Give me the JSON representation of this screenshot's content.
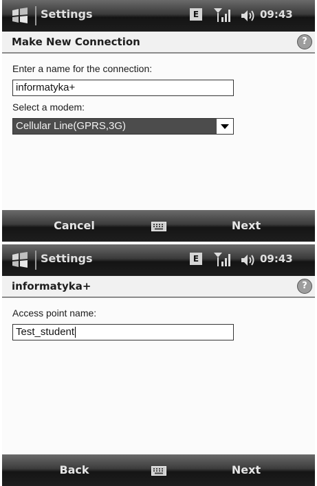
{
  "screens": [
    {
      "title_bar": {
        "app_title": "Settings",
        "network_badge": "E",
        "time": "09:43",
        "icons": [
          "windows-start-icon",
          "signal-icon",
          "speaker-icon"
        ]
      },
      "header": {
        "title": "Make New Connection",
        "help_label": "?"
      },
      "form": {
        "name_label": "Enter a name for the connection:",
        "name_value": "informatyka+",
        "modem_label": "Select a modem:",
        "modem_value": "Cellular Line(GPRS,3G)"
      },
      "softkeys": {
        "left": "Cancel",
        "right": "Next",
        "center_icon": "keyboard-icon"
      }
    },
    {
      "title_bar": {
        "app_title": "Settings",
        "network_badge": "E",
        "time": "09:43",
        "icons": [
          "windows-start-icon",
          "signal-icon",
          "speaker-icon"
        ]
      },
      "header": {
        "title": "informatyka+",
        "help_label": "?"
      },
      "form": {
        "apn_label": "Access point name:",
        "apn_value": "Test_student"
      },
      "softkeys": {
        "left": "Back",
        "right": "Next",
        "center_icon": "keyboard-icon"
      }
    }
  ]
}
